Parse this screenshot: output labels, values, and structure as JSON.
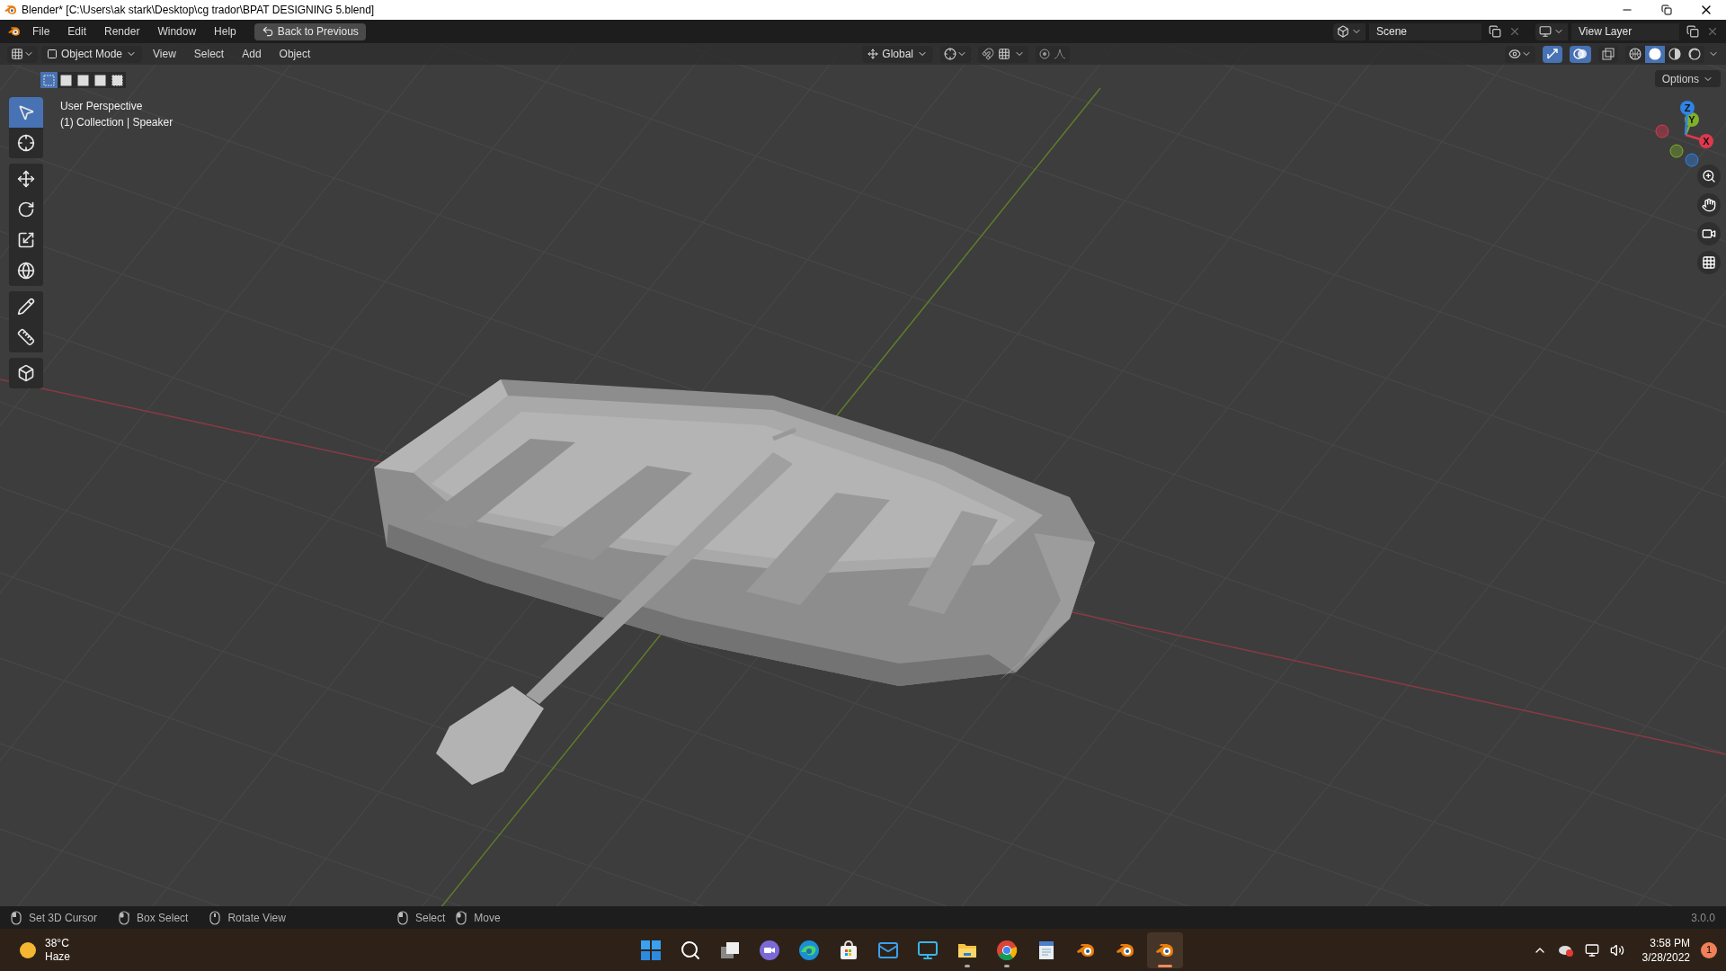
{
  "window": {
    "title": "Blender* [C:\\Users\\ak stark\\Desktop\\cg trador\\BPAT DESIGNING 5.blend]"
  },
  "menu": [
    "File",
    "Edit",
    "Render",
    "Window",
    "Help"
  ],
  "back_button": "Back to Previous",
  "scene": "Scene",
  "view_layer": "View Layer",
  "header": {
    "mode": "Object Mode",
    "menus": [
      "View",
      "Select",
      "Add",
      "Object"
    ],
    "orientation": "Global",
    "options": "Options"
  },
  "select_modes": [
    {
      "selected": true
    },
    {
      "selected": false
    },
    {
      "selected": false
    },
    {
      "selected": false
    },
    {
      "selected": false
    }
  ],
  "viewport_toggles": [
    {
      "kind": "gizmo",
      "on": true
    },
    {
      "kind": "overlays",
      "on": true
    },
    {
      "kind": "xray",
      "on": false
    }
  ],
  "shading_modes": [
    {
      "kind": "wireframe",
      "selected": false
    },
    {
      "kind": "solid",
      "selected": true
    },
    {
      "kind": "material",
      "selected": false
    },
    {
      "kind": "rendered",
      "selected": false
    }
  ],
  "viewport_info": [
    "User Perspective",
    "(1) Collection | Speaker"
  ],
  "tools": [
    {
      "kind": "select",
      "selected": true
    },
    {
      "kind": "cursor",
      "selected": false
    },
    {
      "kind": "move",
      "selected": false
    },
    {
      "kind": "rotate",
      "selected": false
    },
    {
      "kind": "scale",
      "selected": false
    },
    {
      "kind": "transform",
      "selected": false
    },
    {
      "kind": "annotate",
      "selected": false
    },
    {
      "kind": "measure",
      "selected": false
    },
    {
      "kind": "add-cube",
      "selected": false
    }
  ],
  "gizmo": {
    "axes": [
      {
        "label": "X",
        "color": "#e0384f"
      },
      {
        "label": "Y",
        "color": "#7fb02a"
      },
      {
        "label": "Z",
        "color": "#2f83e6"
      }
    ]
  },
  "status_bar": {
    "left": [
      {
        "kind": "left",
        "label": "Set 3D Cursor"
      },
      {
        "kind": "drag",
        "label": "Box Select"
      },
      {
        "kind": "middle",
        "label": "Rotate View"
      }
    ],
    "center": [
      {
        "kind": "left",
        "label": "Select"
      },
      {
        "kind": "drag",
        "label": "Move"
      }
    ],
    "version": "3.0.0"
  },
  "taskbar": {
    "weather": {
      "temperature": "38°C",
      "condition": "Haze"
    },
    "apps": [
      {
        "kind": "start",
        "running": false,
        "selected": false
      },
      {
        "kind": "search",
        "running": false,
        "selected": false
      },
      {
        "kind": "taskview",
        "running": false,
        "selected": false
      },
      {
        "kind": "chat",
        "running": false,
        "selected": false
      },
      {
        "kind": "browser",
        "running": false,
        "selected": false
      },
      {
        "kind": "store",
        "running": false,
        "selected": false
      },
      {
        "kind": "mail",
        "running": false,
        "selected": false
      },
      {
        "kind": "monitor",
        "running": false,
        "selected": false
      },
      {
        "kind": "folder",
        "running": true,
        "selected": false
      },
      {
        "kind": "chrome",
        "running": true,
        "selected": false
      },
      {
        "kind": "document",
        "running": false,
        "selected": false
      },
      {
        "kind": "blender",
        "running": false,
        "selected": false
      },
      {
        "kind": "blender",
        "running": false,
        "selected": false
      },
      {
        "kind": "blender",
        "running": true,
        "selected": true
      }
    ],
    "clock": {
      "time": "3:58 PM",
      "date": "3/28/2022"
    },
    "notifications": "1"
  }
}
